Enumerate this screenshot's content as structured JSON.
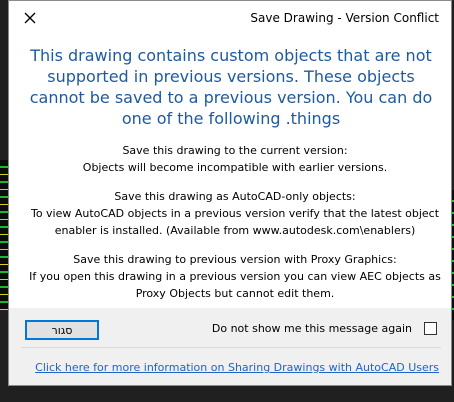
{
  "dialog": {
    "title": "Save Drawing - Version Conflict",
    "headline": "This drawing contains custom objects that are not supported in previous versions. These objects cannot be saved to a previous version. You can do one of the following .things",
    "options": [
      {
        "lines": [
          ":Save this drawing to the current version",
          ".Objects will become incompatible with earlier versions"
        ]
      },
      {
        "lines": [
          ":Save this drawing as AutoCAD-only objects",
          "To view AutoCAD objects in a previous version verify that the latest object",
          "enabler is installed. (Available from www.autodesk.com\\enablers)"
        ]
      },
      {
        "lines": [
          ":Save this drawing to previous version with Proxy Graphics",
          "If you open this drawing in a previous version you can view AEC objects as",
          ".Proxy Objects but cannot edit them"
        ]
      }
    ],
    "close_button_label": "סגור",
    "dont_show_label": "Do not show me this message again",
    "dont_show_checked": false,
    "info_link": "Click here for more information on Sharing Drawings with AutoCAD Users",
    "icons": {
      "close": "close-icon"
    },
    "colors": {
      "headline": "#1e5aa0",
      "link": "#1e64c8",
      "button_border": "#0078d7"
    }
  }
}
